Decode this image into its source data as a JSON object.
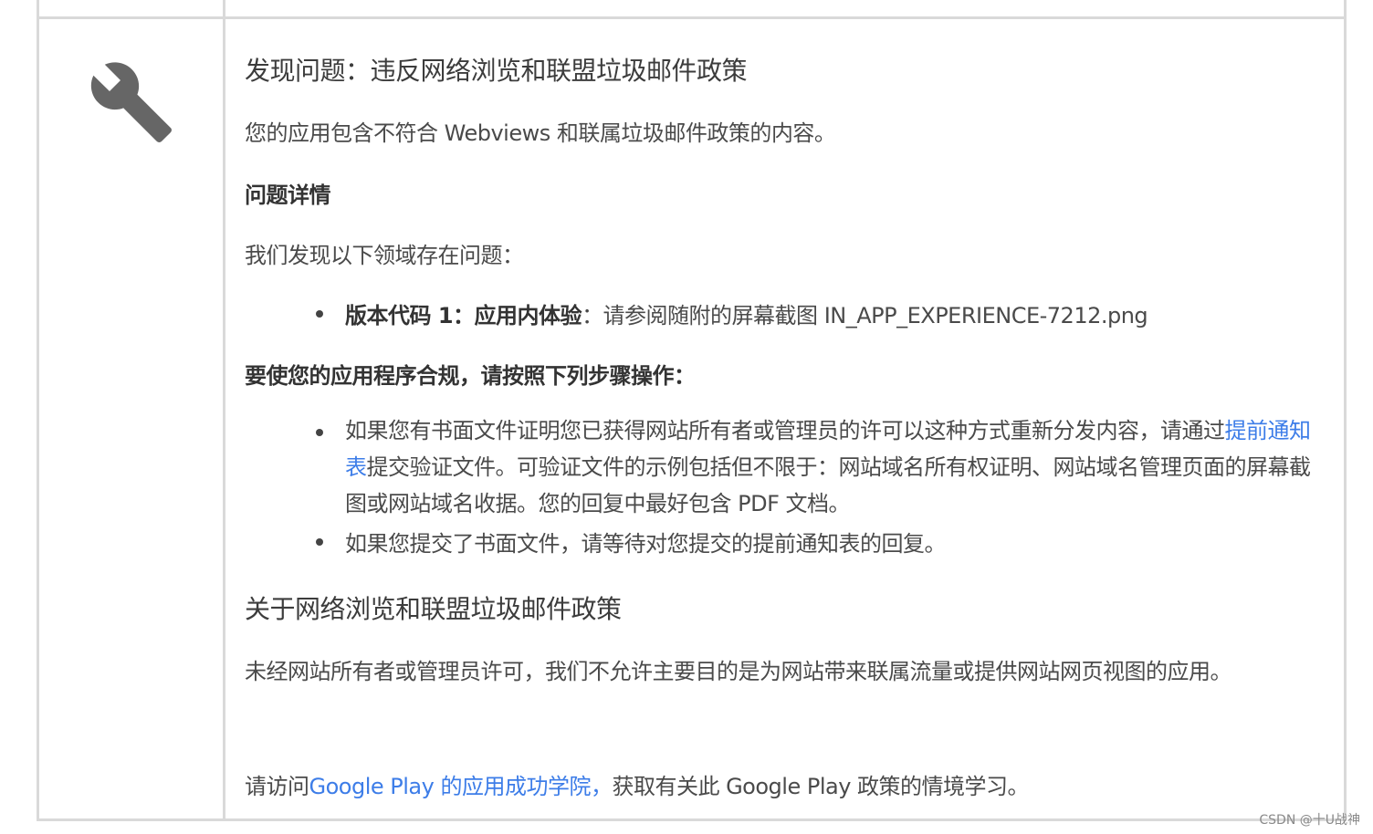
{
  "issue": {
    "title": "发现问题：违反网络浏览和联盟垃圾邮件政策",
    "summary": "您的应用包含不符合 Webviews 和联属垃圾邮件政策的内容。",
    "details_heading": "问题详情",
    "details_intro": "我们发现以下领域存在问题：",
    "details_items": [
      {
        "label": "版本代码 1：应用内体验",
        "text": "：请参阅随附的屏幕截图 IN_APP_EXPERIENCE-7212.png"
      }
    ],
    "steps_heading": "要使您的应用程序合规，请按照下列步骤操作：",
    "steps": [
      {
        "pre": "如果您有书面文件证明您已获得网站所有者或管理员的许可以这种方式重新分发内容，请通过",
        "link": "提前通知表",
        "post": "提交验证文件。可验证文件的示例包括但不限于：网站域名所有权证明、网站域名管理页面的屏幕截图或网站域名收据。您的回复中最好包含 PDF 文档。"
      },
      {
        "pre": "如果您提交了书面文件，请等待对您提交的提前通知表的回复。",
        "link": "",
        "post": ""
      }
    ],
    "policy_heading": "关于网络浏览和联盟垃圾邮件政策",
    "policy_text": "未经网站所有者或管理员许可，我们不允许主要目的是为网站带来联属流量或提供网站网页视图的应用。",
    "academy_pre": "请访问",
    "academy_link": "Google Play 的应用成功学院，",
    "academy_post": "获取有关此 Google Play 政策的情境学习。"
  },
  "watermark": "CSDN @十U战神",
  "icon": "wrench-icon",
  "colors": {
    "link": "#3d7de8",
    "border": "#d9d9d9",
    "icon": "#666666"
  }
}
